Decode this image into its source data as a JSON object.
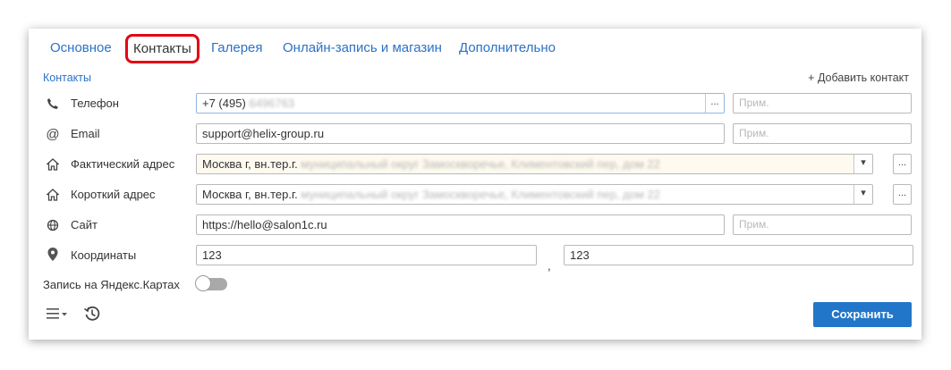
{
  "tabs": [
    {
      "label": "Основное"
    },
    {
      "label": "Контакты"
    },
    {
      "label": "Галерея"
    },
    {
      "label": "Онлайн-запись и магазин"
    },
    {
      "label": "Дополнительно"
    }
  ],
  "section_title": "Контакты",
  "add_contact": "+ Добавить контакт",
  "note_placeholder": "Прим.",
  "rows": {
    "phone": {
      "label": "Телефон",
      "value": "+7 (495)",
      "value_hidden": "6496763",
      "more": "..."
    },
    "email": {
      "label": "Email",
      "value": "support@helix-group.ru"
    },
    "actual_address": {
      "label": "Фактический адрес",
      "value": "Москва г, вн.тер.г.",
      "value_hidden": "муниципальный округ Замоскворечье, Климентовский пер, дом 22",
      "dropdown": "▾",
      "more": "..."
    },
    "short_address": {
      "label": "Короткий адрес",
      "value": "Москва г, вн.тер.г.",
      "value_hidden": "муниципальный округ Замоскворечье, Климентовский пер, дом 22",
      "dropdown": "▾",
      "more": "..."
    },
    "site": {
      "label": "Сайт",
      "value": "https://hello@salon1c.ru"
    },
    "coords": {
      "label": "Координаты",
      "lat": "123",
      "separator": ",",
      "lon": "123"
    }
  },
  "yandex_toggle": {
    "label": "Запись на Яндекс.Картах",
    "on": false
  },
  "save_label": "Сохранить",
  "colors": {
    "accent": "#2276c9",
    "link": "#2b72c6",
    "highlight": "#e30613"
  },
  "icons": [
    "phone-icon",
    "at-icon",
    "home-icon",
    "home-icon",
    "globe-icon",
    "map-pin-icon",
    "menu-icon",
    "history-icon"
  ]
}
